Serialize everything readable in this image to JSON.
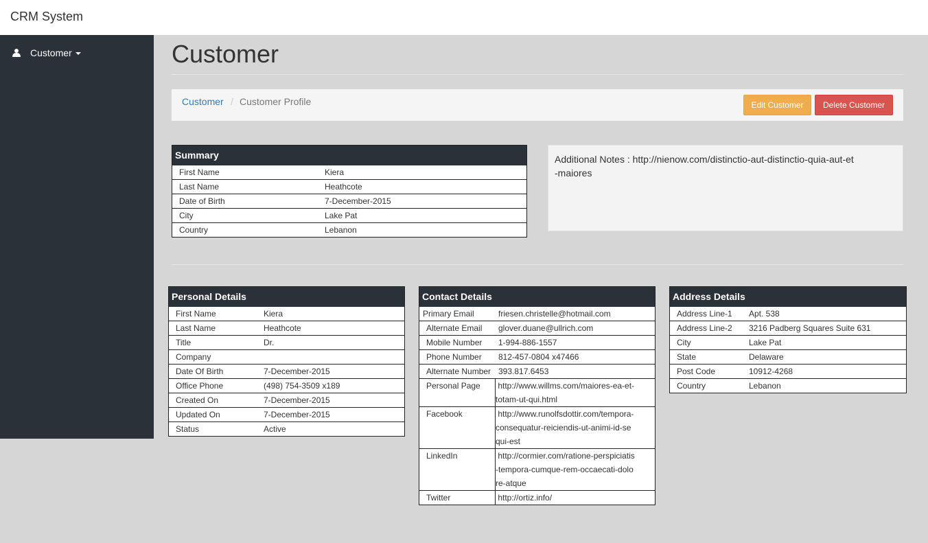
{
  "app": {
    "title": "CRM System"
  },
  "sidebar": {
    "items": [
      {
        "label": "Customer"
      }
    ]
  },
  "page": {
    "title": "Customer"
  },
  "breadcrumb": {
    "link": "Customer",
    "separator": "/",
    "current": "Customer Profile"
  },
  "actions": {
    "edit_label": "Edit Customer",
    "delete_label": "Delete Customer"
  },
  "colors": {
    "sidebar": "#2b3138",
    "edit": "#f0ad4e",
    "delete": "#d9534f",
    "link": "#337ab7"
  },
  "summary": {
    "title": "Summary",
    "rows": [
      {
        "label": "First Name",
        "value": "Kiera"
      },
      {
        "label": "Last Name",
        "value": "Heathcote"
      },
      {
        "label": "Date of Birth",
        "value": "7-December-2015"
      },
      {
        "label": "City",
        "value": "Lake Pat"
      },
      {
        "label": "Country",
        "value": "Lebanon"
      }
    ]
  },
  "notes": {
    "text": "Additional Notes : http://nienow.com/distinctio-aut-distinctio-quia-aut-et-maiores"
  },
  "personal": {
    "title": "Personal Details",
    "rows": [
      {
        "label": "First Name",
        "value": "Kiera"
      },
      {
        "label": "Last Name",
        "value": "Heathcote"
      },
      {
        "label": "Title",
        "value": "Dr."
      },
      {
        "label": "Company",
        "value": ""
      },
      {
        "label": "Date Of Birth",
        "value": "7-December-2015"
      },
      {
        "label": "Office Phone",
        "value": "(498) 754-3509 x189"
      },
      {
        "label": "Created On",
        "value": "7-December-2015"
      },
      {
        "label": "Updated On",
        "value": "7-December-2015"
      },
      {
        "label": "Status",
        "value": "Active"
      }
    ]
  },
  "contact": {
    "title": "Contact Details",
    "rows": [
      {
        "label": "Primary Email",
        "value": "friesen.christelle@hotmail.com"
      },
      {
        "label": "Alternate Email",
        "value": "glover.duane@ullrich.com"
      },
      {
        "label": "Mobile Number",
        "value": "1-994-886-1557"
      },
      {
        "label": "Phone Number",
        "value": "812-457-0804 x47466"
      },
      {
        "label": "Alternate Number",
        "value": "393.817.6453"
      },
      {
        "label": "Personal Page",
        "value": " http://www.willms.com/maiores-ea-et-totam-ut-qui.html"
      },
      {
        "label": "Facebook",
        "value": " http://www.runolfsdottir.com/tempora-consequatur-reiciendis-ut-animi-id-sequi-est"
      },
      {
        "label": "LinkedIn",
        "value": " http://cormier.com/ratione-perspiciatis-tempora-cumque-rem-occaecati-dolore-atque"
      },
      {
        "label": "Twitter",
        "value": " http://ortiz.info/"
      }
    ]
  },
  "address": {
    "title": "Address Details",
    "rows": [
      {
        "label": "Address Line-1",
        "value": "Apt. 538"
      },
      {
        "label": "Address Line-2",
        "value": "3216 Padberg Squares Suite 631"
      },
      {
        "label": "City",
        "value": "Lake Pat"
      },
      {
        "label": "State",
        "value": "Delaware"
      },
      {
        "label": "Post Code",
        "value": "10912-4268"
      },
      {
        "label": "Country",
        "value": "Lebanon"
      }
    ]
  }
}
